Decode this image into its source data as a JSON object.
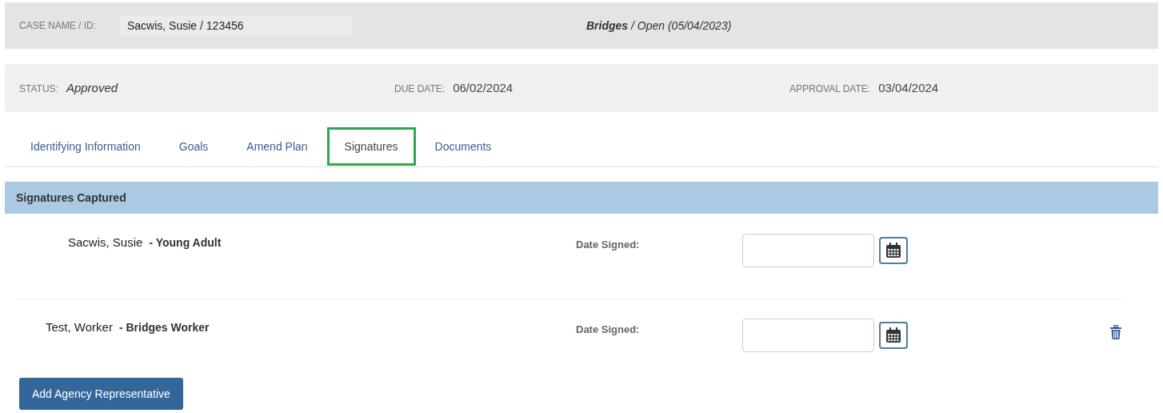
{
  "case_header": {
    "label": "CASE NAME / ID:",
    "value": "Sacwis, Susie / 123456",
    "program": "**Bridges** / Open (05/04/2023)"
  },
  "status_bar": {
    "status_label": "STATUS:",
    "status": "Approved",
    "due_label": "DUE DATE:",
    "due_date": "06/02/2024",
    "approval_label": "APPROVAL DATE:",
    "approval_date": "03/04/2024"
  },
  "tabs": [
    {
      "label": "Identifying Information",
      "selected": false
    },
    {
      "label": "Goals",
      "selected": false
    },
    {
      "label": "Amend Plan",
      "selected": false
    },
    {
      "label": "Signatures",
      "selected": true
    },
    {
      "label": "Documents",
      "selected": false
    }
  ],
  "section": {
    "title": "Signatures Captured"
  },
  "signatures": [
    {
      "kind": "participant",
      "name": "Sacwis, Susie",
      "role": "- Young Adult",
      "date_label": "Date Signed:",
      "deletable": false
    },
    {
      "kind": "agency",
      "name": "Test, Worker",
      "role": "- Bridges Worker",
      "date_label": "Date Signed:",
      "deletable": true
    }
  ],
  "add_button": "Add Agency Representative"
}
